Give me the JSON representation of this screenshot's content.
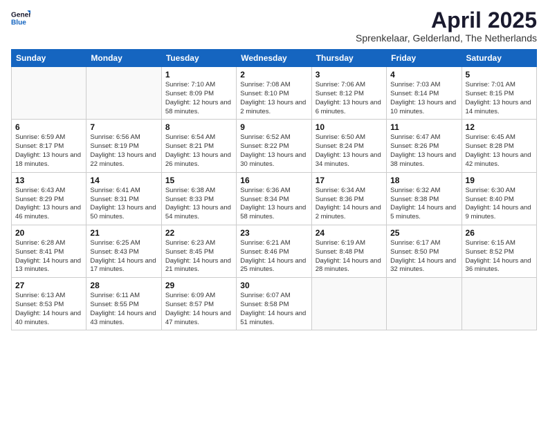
{
  "header": {
    "logo_general": "General",
    "logo_blue": "Blue",
    "month_title": "April 2025",
    "subtitle": "Sprenkelaar, Gelderland, The Netherlands"
  },
  "weekdays": [
    "Sunday",
    "Monday",
    "Tuesday",
    "Wednesday",
    "Thursday",
    "Friday",
    "Saturday"
  ],
  "weeks": [
    [
      {
        "day": "",
        "info": ""
      },
      {
        "day": "",
        "info": ""
      },
      {
        "day": "1",
        "info": "Sunrise: 7:10 AM\nSunset: 8:09 PM\nDaylight: 12 hours and 58 minutes."
      },
      {
        "day": "2",
        "info": "Sunrise: 7:08 AM\nSunset: 8:10 PM\nDaylight: 13 hours and 2 minutes."
      },
      {
        "day": "3",
        "info": "Sunrise: 7:06 AM\nSunset: 8:12 PM\nDaylight: 13 hours and 6 minutes."
      },
      {
        "day": "4",
        "info": "Sunrise: 7:03 AM\nSunset: 8:14 PM\nDaylight: 13 hours and 10 minutes."
      },
      {
        "day": "5",
        "info": "Sunrise: 7:01 AM\nSunset: 8:15 PM\nDaylight: 13 hours and 14 minutes."
      }
    ],
    [
      {
        "day": "6",
        "info": "Sunrise: 6:59 AM\nSunset: 8:17 PM\nDaylight: 13 hours and 18 minutes."
      },
      {
        "day": "7",
        "info": "Sunrise: 6:56 AM\nSunset: 8:19 PM\nDaylight: 13 hours and 22 minutes."
      },
      {
        "day": "8",
        "info": "Sunrise: 6:54 AM\nSunset: 8:21 PM\nDaylight: 13 hours and 26 minutes."
      },
      {
        "day": "9",
        "info": "Sunrise: 6:52 AM\nSunset: 8:22 PM\nDaylight: 13 hours and 30 minutes."
      },
      {
        "day": "10",
        "info": "Sunrise: 6:50 AM\nSunset: 8:24 PM\nDaylight: 13 hours and 34 minutes."
      },
      {
        "day": "11",
        "info": "Sunrise: 6:47 AM\nSunset: 8:26 PM\nDaylight: 13 hours and 38 minutes."
      },
      {
        "day": "12",
        "info": "Sunrise: 6:45 AM\nSunset: 8:28 PM\nDaylight: 13 hours and 42 minutes."
      }
    ],
    [
      {
        "day": "13",
        "info": "Sunrise: 6:43 AM\nSunset: 8:29 PM\nDaylight: 13 hours and 46 minutes."
      },
      {
        "day": "14",
        "info": "Sunrise: 6:41 AM\nSunset: 8:31 PM\nDaylight: 13 hours and 50 minutes."
      },
      {
        "day": "15",
        "info": "Sunrise: 6:38 AM\nSunset: 8:33 PM\nDaylight: 13 hours and 54 minutes."
      },
      {
        "day": "16",
        "info": "Sunrise: 6:36 AM\nSunset: 8:34 PM\nDaylight: 13 hours and 58 minutes."
      },
      {
        "day": "17",
        "info": "Sunrise: 6:34 AM\nSunset: 8:36 PM\nDaylight: 14 hours and 2 minutes."
      },
      {
        "day": "18",
        "info": "Sunrise: 6:32 AM\nSunset: 8:38 PM\nDaylight: 14 hours and 5 minutes."
      },
      {
        "day": "19",
        "info": "Sunrise: 6:30 AM\nSunset: 8:40 PM\nDaylight: 14 hours and 9 minutes."
      }
    ],
    [
      {
        "day": "20",
        "info": "Sunrise: 6:28 AM\nSunset: 8:41 PM\nDaylight: 14 hours and 13 minutes."
      },
      {
        "day": "21",
        "info": "Sunrise: 6:25 AM\nSunset: 8:43 PM\nDaylight: 14 hours and 17 minutes."
      },
      {
        "day": "22",
        "info": "Sunrise: 6:23 AM\nSunset: 8:45 PM\nDaylight: 14 hours and 21 minutes."
      },
      {
        "day": "23",
        "info": "Sunrise: 6:21 AM\nSunset: 8:46 PM\nDaylight: 14 hours and 25 minutes."
      },
      {
        "day": "24",
        "info": "Sunrise: 6:19 AM\nSunset: 8:48 PM\nDaylight: 14 hours and 28 minutes."
      },
      {
        "day": "25",
        "info": "Sunrise: 6:17 AM\nSunset: 8:50 PM\nDaylight: 14 hours and 32 minutes."
      },
      {
        "day": "26",
        "info": "Sunrise: 6:15 AM\nSunset: 8:52 PM\nDaylight: 14 hours and 36 minutes."
      }
    ],
    [
      {
        "day": "27",
        "info": "Sunrise: 6:13 AM\nSunset: 8:53 PM\nDaylight: 14 hours and 40 minutes."
      },
      {
        "day": "28",
        "info": "Sunrise: 6:11 AM\nSunset: 8:55 PM\nDaylight: 14 hours and 43 minutes."
      },
      {
        "day": "29",
        "info": "Sunrise: 6:09 AM\nSunset: 8:57 PM\nDaylight: 14 hours and 47 minutes."
      },
      {
        "day": "30",
        "info": "Sunrise: 6:07 AM\nSunset: 8:58 PM\nDaylight: 14 hours and 51 minutes."
      },
      {
        "day": "",
        "info": ""
      },
      {
        "day": "",
        "info": ""
      },
      {
        "day": "",
        "info": ""
      }
    ]
  ]
}
